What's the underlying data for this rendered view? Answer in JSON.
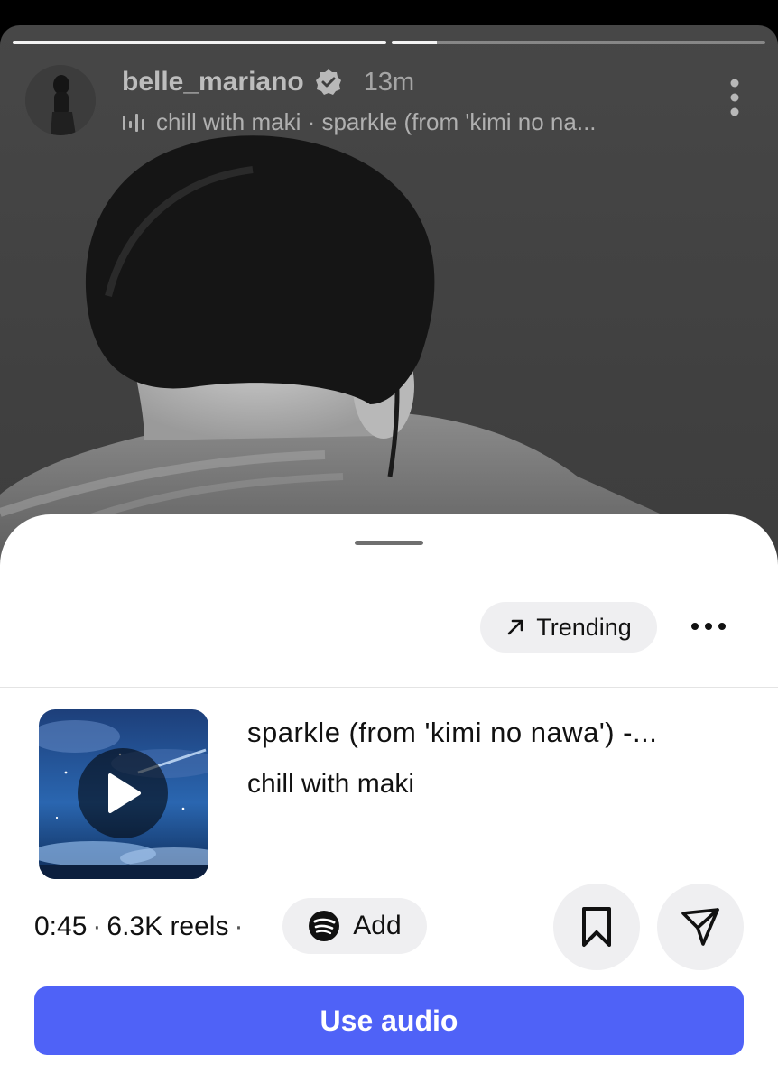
{
  "story": {
    "progress": [
      {
        "fill": 1.0
      },
      {
        "fill": 0.12
      }
    ],
    "username": "belle_mariano",
    "time": "13m",
    "music": "chill with maki · sparkle (from 'kimi no na...",
    "icons": {
      "verified": "verified-badge-icon",
      "music": "music-bars-icon",
      "more": "more-vertical-icon"
    }
  },
  "sheet": {
    "trending_label": "Trending",
    "track": {
      "title": "sparkle (from 'kimi no nawa') -...",
      "artist": "chill with maki"
    },
    "meta": {
      "duration": "0:45",
      "reels": "6.3K reels",
      "separator": "·"
    },
    "add_label": "Add",
    "use_audio_label": "Use audio",
    "colors": {
      "accent": "#4f62f7",
      "chip_bg": "#efeff1"
    }
  }
}
